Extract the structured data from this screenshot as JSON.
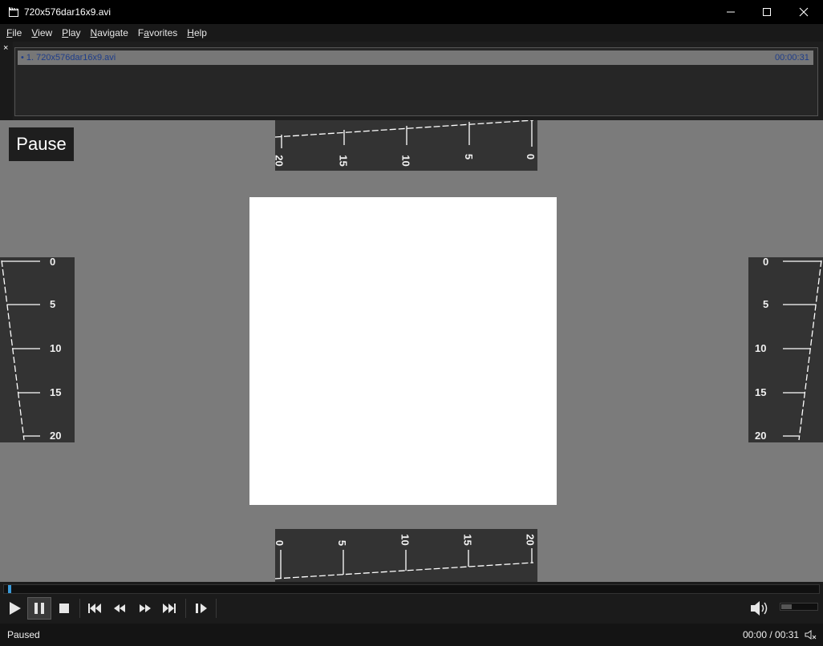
{
  "window": {
    "title": "720x576dar16x9.avi"
  },
  "menu": [
    {
      "label": "File"
    },
    {
      "label": "View"
    },
    {
      "label": "Play"
    },
    {
      "label": "Navigate"
    },
    {
      "label": "Favorites"
    },
    {
      "label": "Help"
    }
  ],
  "playlist": {
    "close_glyph": "×",
    "items": [
      {
        "label": "• 1. 720x576dar16x9.avi",
        "duration": "00:00:31"
      }
    ]
  },
  "video": {
    "osd_text": "Pause",
    "ruler_top_labels": [
      "20",
      "15",
      "10",
      "5",
      "0"
    ],
    "ruler_bottom_labels": [
      "0",
      "5",
      "10",
      "15",
      "20"
    ],
    "ruler_left_labels": [
      "0",
      "5",
      "10",
      "15",
      "20"
    ],
    "ruler_right_labels": [
      "0",
      "5",
      "10",
      "15",
      "20"
    ]
  },
  "seek": {
    "position_fraction": 0.0
  },
  "controls": {
    "icons": [
      "play-icon",
      "pause-icon",
      "stop-icon",
      "skip-previous-icon",
      "rewind-icon",
      "fast-forward-icon",
      "skip-next-icon",
      "frame-step-icon",
      "volume-icon"
    ],
    "active": "pause-button",
    "volume_fraction": 0.3
  },
  "status": {
    "state": "Paused",
    "time": "00:00 / 00:31"
  },
  "colors": {
    "accent": "#3a9ad9",
    "playlist_text": "#1e3d8a",
    "video_background": "#7b7b7b"
  }
}
